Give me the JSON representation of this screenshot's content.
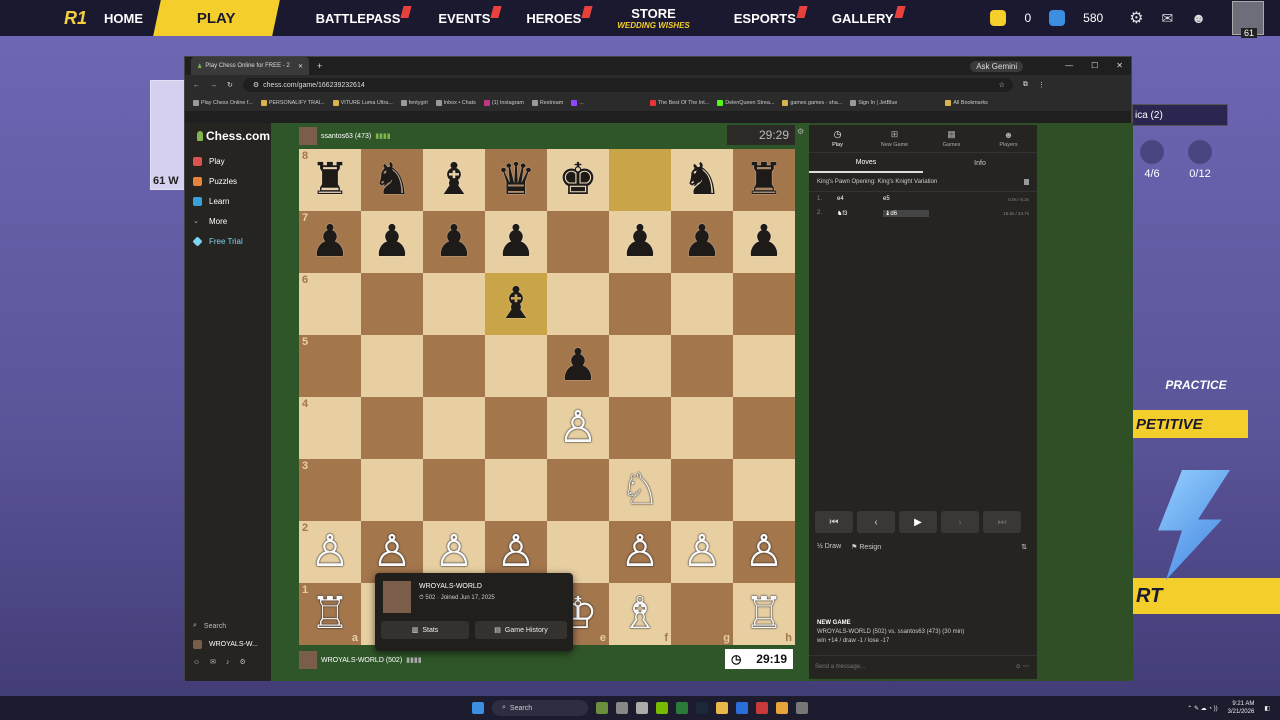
{
  "game": {
    "logo": "R1",
    "nav": [
      {
        "label": "HOME"
      },
      {
        "label": "PLAY"
      },
      {
        "label": "BATTLEPASS"
      },
      {
        "label": "EVENTS"
      },
      {
        "label": "HEROES"
      },
      {
        "label": "STORE",
        "sublabel": "WEDDING WISHES"
      },
      {
        "label": "ESPORTS"
      },
      {
        "label": "GALLERY"
      }
    ],
    "currency_a": "0",
    "currency_b": "580",
    "level": "61",
    "side_level": "61 W",
    "side_tag": "ica (2)",
    "stat_a": "4/6",
    "stat_b": "0/12",
    "practice": "PRACTICE",
    "competitive": "PETITIVE",
    "start": "RT"
  },
  "browser": {
    "tab_title": "Play Chess Online for FREE - 2",
    "gemini": "Ask Gemini",
    "url": "chess.com/game/166239232614",
    "bookmarks": [
      "Play Chess Online f...",
      "PERSONALIFY TRAI...",
      "VITURE Luma Ultra...",
      "fentygirl",
      "Inbox • Chats",
      "(1) Instagram",
      "Restream",
      "...",
      "The Best Of The Int...",
      "DelenQueen Strea...",
      "games games - sha...",
      "Sign In | JetBlue",
      "All Bookmarks"
    ]
  },
  "chess": {
    "brand": "Chess.com",
    "sidebar": [
      "Play",
      "Puzzles",
      "Learn",
      "More",
      "Free Trial"
    ],
    "search": "Search",
    "username": "WROYALS-W...",
    "opponent": "ssantos63 (473)",
    "opponent_clock": "29:29",
    "player": "WROYALS-WORLD (502)",
    "player_clock": "29:19",
    "popup": {
      "name": "WROYALS-WORLD",
      "rating": "502",
      "joined": "Joined Jun 17, 2025",
      "stats": "Stats",
      "history": "Game History"
    },
    "right_tabs": [
      "Play",
      "New Game",
      "Games",
      "Players"
    ],
    "sub_tabs": [
      "Moves",
      "Info"
    ],
    "opening": "King's Pawn Opening: King's Knight Variation",
    "moves": [
      {
        "n": "1.",
        "w": "e4",
        "b": "e5",
        "t": "0.0s / 6.2s"
      },
      {
        "n": "2.",
        "w": "♞f3",
        "b": "♝d6",
        "t": "16.6s / 24.7s"
      }
    ],
    "draw": "Draw",
    "resign": "Resign",
    "newgame_title": "NEW GAME",
    "newgame_line": "WROYALS-WORLD (502) vs. ssantos63 (473) (30 min)",
    "newgame_record": "win +14 / draw -1 / lose -17",
    "send_message": "Send a message..."
  },
  "board": {
    "rows": [
      [
        "♜",
        "♞",
        "♝",
        "♛",
        "♚",
        "",
        "♞",
        "♜"
      ],
      [
        "♟",
        "♟",
        "♟",
        "♟",
        "",
        "♟",
        "♟",
        "♟"
      ],
      [
        "",
        "",
        "",
        "♝",
        "",
        "",
        "",
        ""
      ],
      [
        "",
        "",
        "",
        "",
        "♟",
        "",
        "",
        ""
      ],
      [
        "",
        "",
        "",
        "",
        "♙",
        "",
        "",
        ""
      ],
      [
        "",
        "",
        "",
        "",
        "",
        "♘",
        "",
        ""
      ],
      [
        "♙",
        "♙",
        "♙",
        "♙",
        "",
        "♙",
        "♙",
        "♙"
      ],
      [
        "♖",
        "♘",
        "♗",
        "♕",
        "♔",
        "♗",
        "",
        "♖"
      ]
    ],
    "ranks": [
      "8",
      "7",
      "6",
      "5",
      "4",
      "3",
      "2",
      "1"
    ],
    "files": [
      "a",
      "b",
      "c",
      "d",
      "e",
      "f",
      "g",
      "h"
    ]
  },
  "taskbar": {
    "search": "Search",
    "time": "9:21 AM",
    "date": "3/21/2026"
  }
}
